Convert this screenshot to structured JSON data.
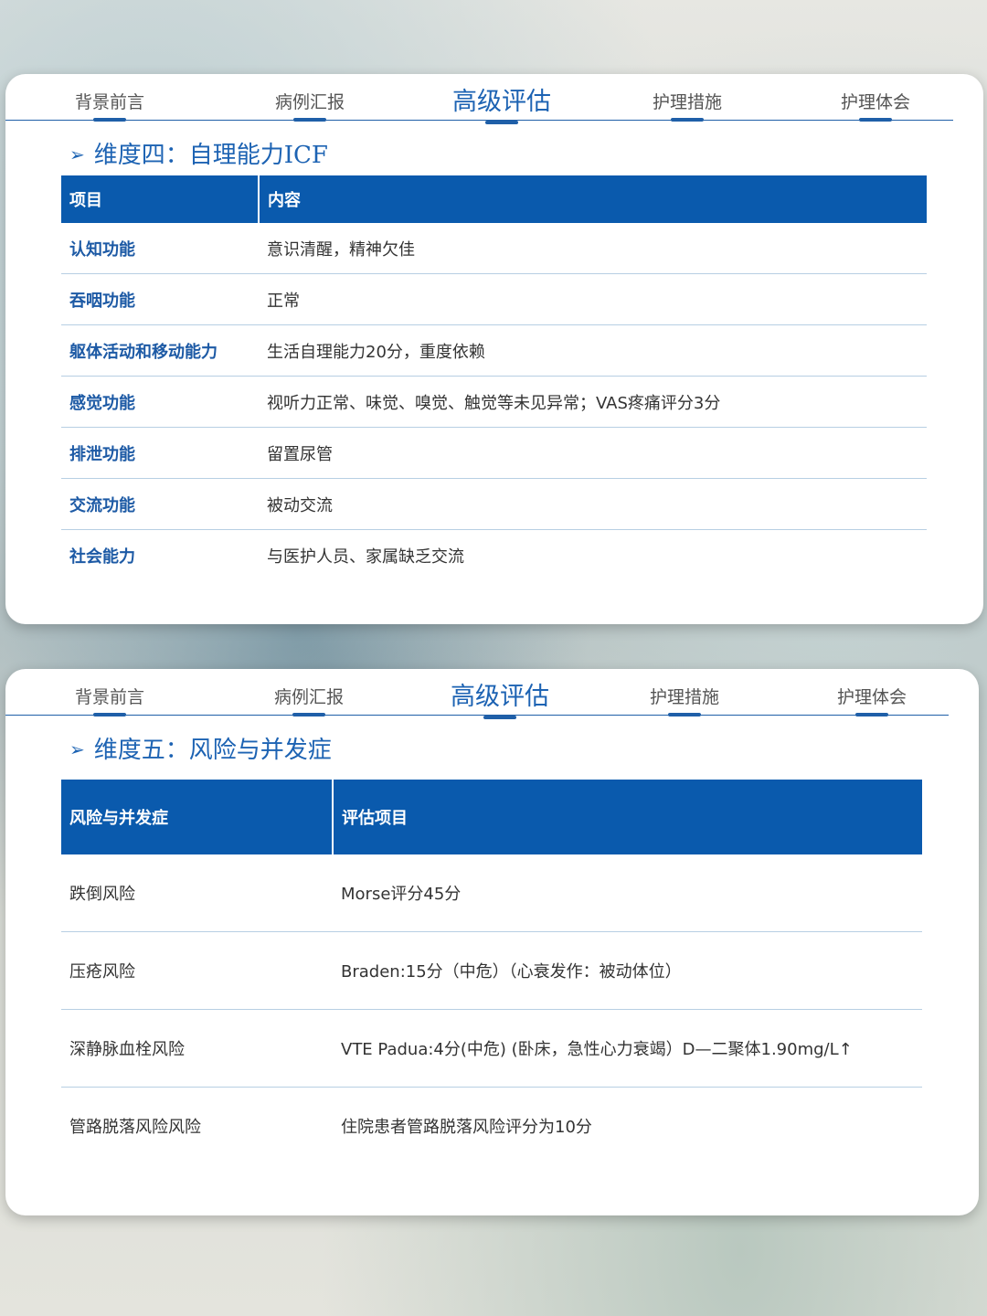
{
  "nav": {
    "items": [
      "背景前言",
      "病例汇报",
      "高级评估",
      "护理措施",
      "护理体会"
    ],
    "active": "高级评估"
  },
  "card1": {
    "title": "维度四：自理能力ICF",
    "headers": [
      "项目",
      "内容"
    ],
    "rows": [
      [
        "认知功能",
        "意识清醒，精神欠佳"
      ],
      [
        "吞咽功能",
        "正常"
      ],
      [
        "躯体活动和移动能力",
        "生活自理能力20分，重度依赖"
      ],
      [
        "感觉功能",
        "视听力正常、味觉、嗅觉、触觉等未见异常；VAS疼痛评分3分"
      ],
      [
        "排泄功能",
        "留置尿管"
      ],
      [
        "交流功能",
        "被动交流"
      ],
      [
        "社会能力",
        "与医护人员、家属缺乏交流"
      ]
    ]
  },
  "card2": {
    "title": "维度五：风险与并发症",
    "headers": [
      "风险与并发症",
      "评估项目"
    ],
    "rows": [
      [
        "跌倒风险",
        "Morse评分45分"
      ],
      [
        "压疮风险",
        "Braden:15分（中危）（心衰发作：被动体位）"
      ],
      [
        "深静脉血栓风险",
        "VTE Padua:4分(中危) (卧床，急性心力衰竭）D—二聚体1.90mg/L↑"
      ],
      [
        "管路脱落风险风险",
        "住院患者管路脱落风险评分为10分"
      ]
    ]
  },
  "colors": {
    "accent": "#1d63b3",
    "header_bg": "#0a5aad",
    "row_line": "#b7cfe3"
  },
  "icons": {
    "section_marker": "arrow-right-icon"
  }
}
